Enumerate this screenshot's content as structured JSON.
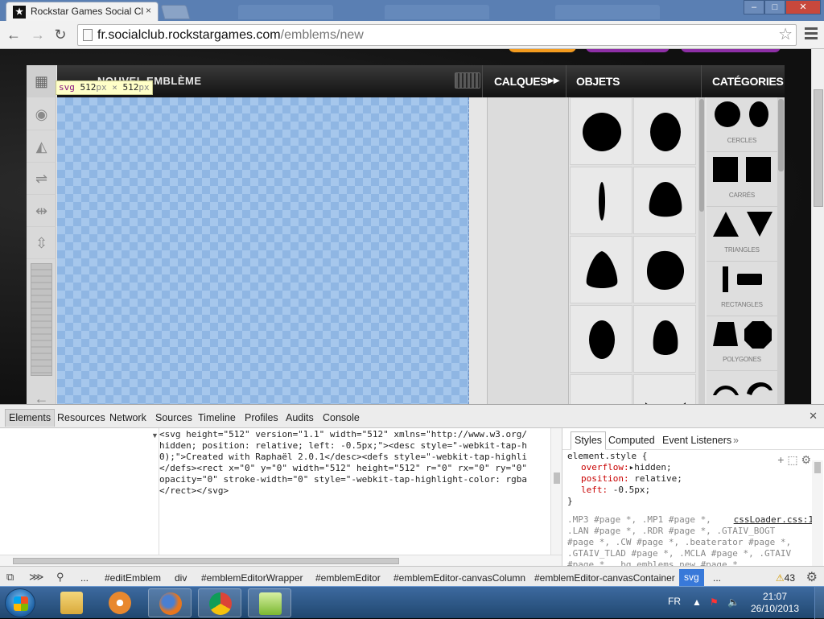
{
  "browser": {
    "active_tab_title": "Rockstar Games Social Clu",
    "active_tab_close": "×",
    "url_host": "fr.socialclub.rockstargames.com",
    "url_path": "/emblems/new",
    "star": "☆",
    "nav": {
      "back": "←",
      "forward": "→",
      "reload": "↻"
    },
    "window_controls": {
      "minimize": "–",
      "maximize": "□",
      "close": "✕"
    }
  },
  "editor": {
    "canvas_title": "NOUVEL EMBLÈME",
    "tooltip": {
      "tag": "svg",
      "w": "512",
      "unit": "px",
      "x": "×",
      "h": "512"
    },
    "header": {
      "calques": "CALQUES",
      "calques_arrow": "▸▸",
      "objets": "OBJETS",
      "categories": "CATÉGORIES"
    },
    "left_tools": [
      {
        "name": "grid-icon",
        "glyph": "▦"
      },
      {
        "name": "eye-icon",
        "glyph": "◉"
      },
      {
        "name": "flip-horizontal-icon",
        "glyph": "◭"
      },
      {
        "name": "flip-vertical-icon",
        "glyph": "⇌"
      },
      {
        "name": "center-horizontal-icon",
        "glyph": "⇹"
      },
      {
        "name": "center-vertical-icon",
        "glyph": "⇳"
      }
    ],
    "undo_glyph": "←",
    "categories": [
      "CERCLES",
      "CARRÉS",
      "TRIANGLES",
      "RECTANGLES",
      "POLYGONES"
    ]
  },
  "devtools": {
    "tabs": [
      "Elements",
      "Resources",
      "Network",
      "Sources",
      "Timeline",
      "Profiles",
      "Audits",
      "Console"
    ],
    "active_tab": "Elements",
    "close": "✕",
    "dom_lines": [
      "<svg height=\"512\" version=\"1.1\" width=\"512\" xmlns=\"http://www.w3.org/",
      "hidden; position: relative; left: -0.5px;\"><desc style=\"-webkit-tap-h",
      "0);\">Created with Raphaël 2.0.1</desc><defs style=\"-webkit-tap-highli",
      "</defs><rect x=\"0\" y=\"0\" width=\"512\" height=\"512\" r=\"0\" rx=\"0\" ry=\"0\"",
      "opacity=\"0\" stroke-width=\"0\" style=\"-webkit-tap-highlight-color: rgba",
      "</rect></svg>"
    ],
    "styles_tabs": [
      "Styles",
      "Computed",
      "Event Listeners"
    ],
    "styles_more": "»",
    "element_style": {
      "selector": "element.style {",
      "props": [
        {
          "p": "overflow:",
          "v": "▸hidden;"
        },
        {
          "p": "position:",
          "v": " relative;"
        },
        {
          "p": "left:",
          "v": " -0.5px;"
        }
      ],
      "close": "}"
    },
    "rules_source": "cssLoader.css:1",
    "rules_lines": [
      ".MP3 #page *, .MP1 #page *,",
      ".LAN #page *, .RDR #page *, .GTAIV_BOGT",
      "#page *, .CW #page *, .beaterator #page *,",
      ".GTAIV_TLAD #page *, .MCLA #page *, .GTAIV",
      "#page *, .bg_emblems_new #page *,"
    ],
    "breadcrumbs": [
      "...",
      "#editEmblem",
      "div",
      "#emblemEditorWrapper",
      "#emblemEditor",
      "#emblemEditor-canvasColumn",
      "#emblemEditor-canvasContainer",
      "svg",
      "..."
    ],
    "warnings": "43"
  },
  "taskbar": {
    "lang": "FR",
    "time": "21:07",
    "date": "26/10/2013"
  }
}
